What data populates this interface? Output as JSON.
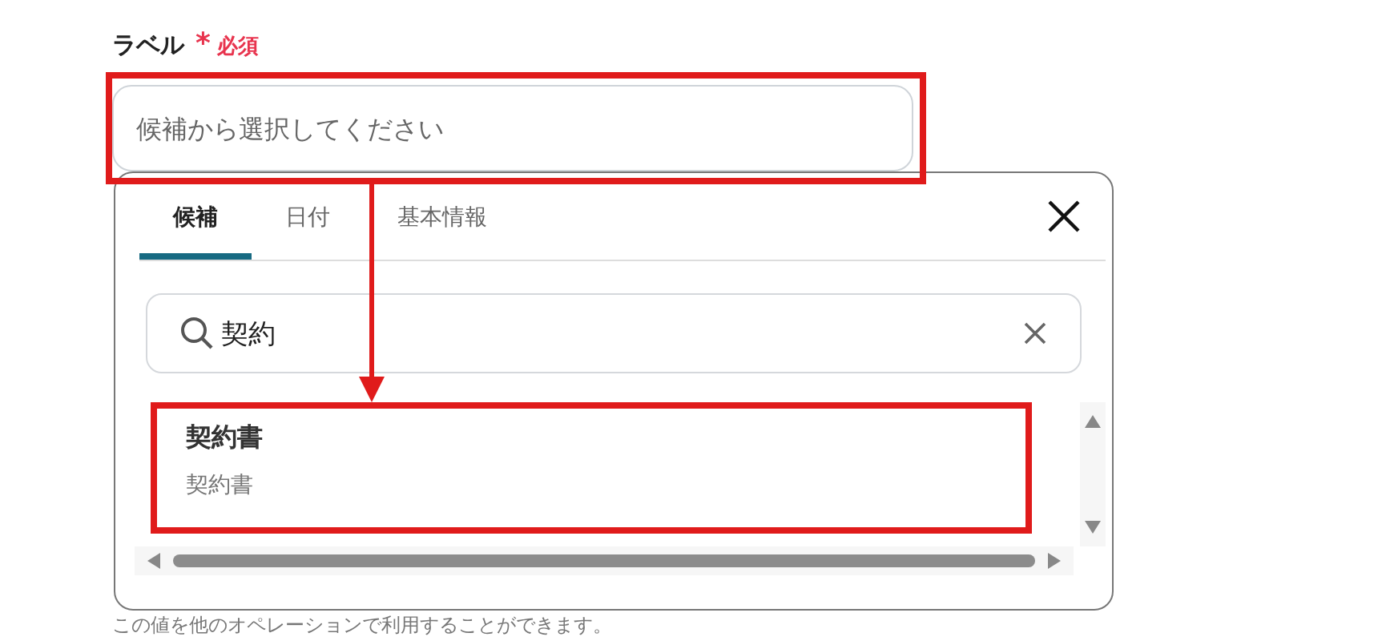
{
  "field": {
    "label": "ラベル",
    "required_mark": "*",
    "required_text": "必須",
    "placeholder": "候補から選択してください",
    "highlighted": true
  },
  "popup": {
    "tabs": [
      {
        "label": "候補",
        "selected": true
      },
      {
        "label": "日付",
        "selected": false
      },
      {
        "label": "基本情報",
        "selected": false
      }
    ],
    "search": {
      "value": "契約"
    },
    "results": [
      {
        "title": "契約書",
        "subtitle": "契約書",
        "highlighted": true
      }
    ]
  },
  "help_text": "この値を他のオペレーションで利用することができます。"
}
